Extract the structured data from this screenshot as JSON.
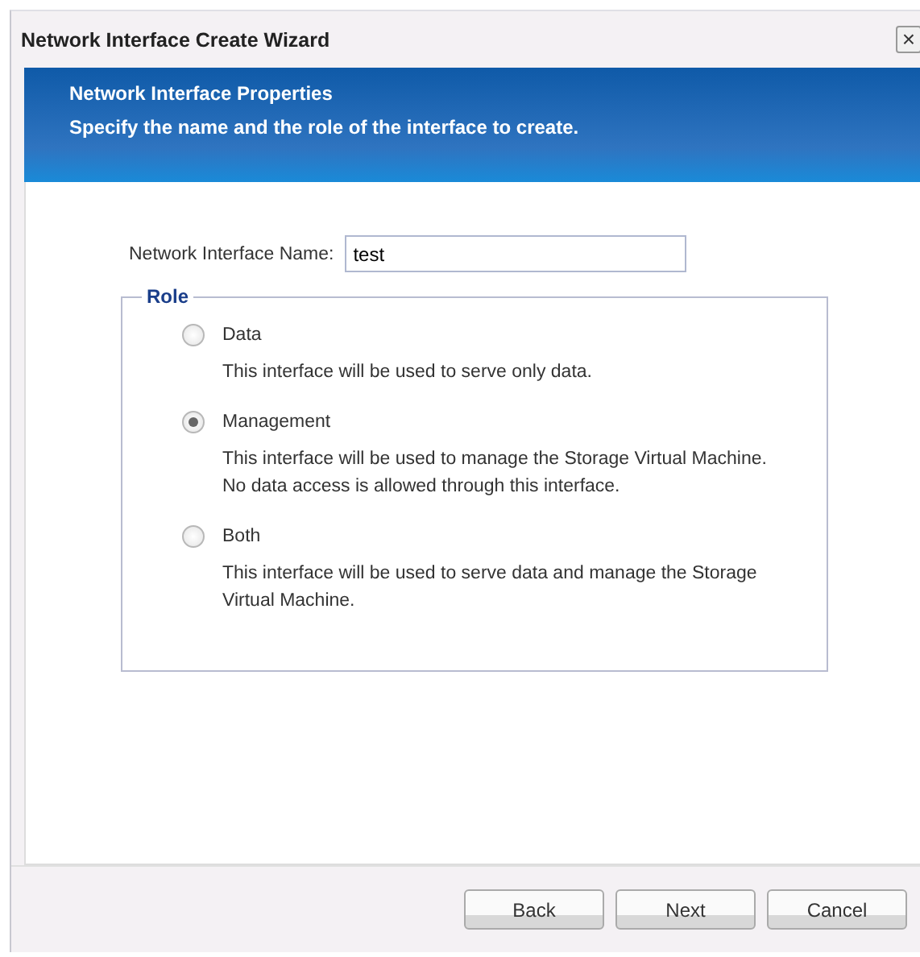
{
  "window": {
    "title": "Network Interface Create Wizard",
    "close": "×"
  },
  "header": {
    "title": "Network Interface Properties",
    "subtitle": "Specify the name and the role of the interface to create."
  },
  "name_field": {
    "label": "Network Interface Name:",
    "value": "test"
  },
  "role": {
    "legend": "Role",
    "options": [
      {
        "label": "Data",
        "selected": false,
        "description": [
          "This interface will be used to serve only data."
        ]
      },
      {
        "label": "Management",
        "selected": true,
        "description": [
          "This interface will be used to manage the Storage Virtual Machine.",
          "No data access is allowed through this interface."
        ]
      },
      {
        "label": "Both",
        "selected": false,
        "description": [
          "This interface will be used to serve data and manage the Storage Virtual Machine."
        ]
      }
    ]
  },
  "buttons": [
    "Back",
    "Next",
    "Cancel"
  ]
}
